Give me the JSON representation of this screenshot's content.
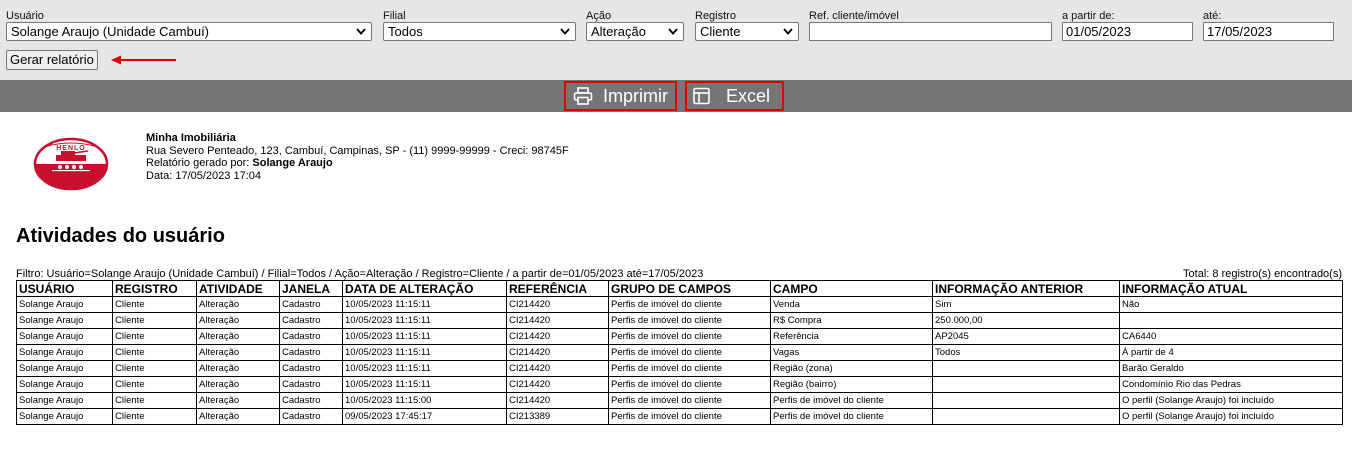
{
  "filters": {
    "usuario": {
      "label": "Usuário",
      "value": "Solange Araujo (Unidade Cambuí)"
    },
    "filial": {
      "label": "Filial",
      "value": "Todos"
    },
    "acao": {
      "label": "Ação",
      "value": "Alteração"
    },
    "registro": {
      "label": "Registro",
      "value": "Cliente"
    },
    "ref": {
      "label": "Ref. cliente/imóvel",
      "value": ""
    },
    "de": {
      "label": "a partir de:",
      "value": "01/05/2023"
    },
    "ate": {
      "label": "até:",
      "value": "17/05/2023"
    },
    "generate_label": "Gerar relatório"
  },
  "actions": {
    "print_label": "Imprimir",
    "excel_label": "Excel",
    "highlight_color": "#e00000"
  },
  "company": {
    "logo_text": "HENLO",
    "name": "Minha Imobiliária",
    "address": "Rua Severo Penteado, 123, Cambuí, Campinas, SP - (11) 9999-99999 - Creci: 98745F",
    "generated_by_label": "Relatório gerado por: ",
    "generated_by": "Solange Araujo",
    "date": "Data: 17/05/2023 17:04"
  },
  "report": {
    "title": "Atividades do usuário",
    "filter_text": "Filtro: Usuário=Solange Araujo (Unidade Cambuí) / Filial=Todos / Ação=Alteração / Registro=Cliente / a partir de=01/05/2023 até=17/05/2023",
    "total_text": "Total: 8 registro(s) encontrado(s)",
    "columns": [
      "USUÁRIO",
      "REGISTRO",
      "ATIVIDADE",
      "JANELA",
      "DATA DE ALTERAÇÃO",
      "REFERÊNCIA",
      "GRUPO DE CAMPOS",
      "CAMPO",
      "INFORMAÇÃO ANTERIOR",
      "INFORMAÇÃO ATUAL"
    ],
    "rows": [
      [
        "Solange Araujo",
        "Cliente",
        "Alteração",
        "Cadastro",
        "10/05/2023 11:15:11",
        "CI214420",
        "Perfis de imóvel do cliente",
        "Venda",
        "Sim",
        "Não"
      ],
      [
        "Solange Araujo",
        "Cliente",
        "Alteração",
        "Cadastro",
        "10/05/2023 11:15:11",
        "CI214420",
        "Perfis de imóvel do cliente",
        "R$ Compra",
        "250.000,00",
        ""
      ],
      [
        "Solange Araujo",
        "Cliente",
        "Alteração",
        "Cadastro",
        "10/05/2023 11:15:11",
        "CI214420",
        "Perfis de imóvel do cliente",
        "Referência",
        "AP2045",
        "CA6440"
      ],
      [
        "Solange Araujo",
        "Cliente",
        "Alteração",
        "Cadastro",
        "10/05/2023 11:15:11",
        "CI214420",
        "Perfis de imóvel do cliente",
        "Vagas",
        "Todos",
        "À partir de 4"
      ],
      [
        "Solange Araujo",
        "Cliente",
        "Alteração",
        "Cadastro",
        "10/05/2023 11:15:11",
        "CI214420",
        "Perfis de imóvel do cliente",
        "Região (zona)",
        "",
        "Barão Geraldo"
      ],
      [
        "Solange Araujo",
        "Cliente",
        "Alteração",
        "Cadastro",
        "10/05/2023 11:15:11",
        "CI214420",
        "Perfis de imóvel do cliente",
        "Região (bairro)",
        "",
        "Condomínio Rio das Pedras"
      ],
      [
        "Solange Araujo",
        "Cliente",
        "Alteração",
        "Cadastro",
        "10/05/2023 11:15:00",
        "CI214420",
        "Perfis de imóvel do cliente",
        "Perfis de imóvel do cliente",
        "",
        "O perfil (Solange Araujo) foi incluído"
      ],
      [
        "Solange Araujo",
        "Cliente",
        "Alteração",
        "Cadastro",
        "09/05/2023 17:45:17",
        "CI213389",
        "Perfis de imóvel do cliente",
        "Perfis de imóvel do cliente",
        "",
        "O perfil (Solange Araujo) foi incluído"
      ]
    ]
  }
}
